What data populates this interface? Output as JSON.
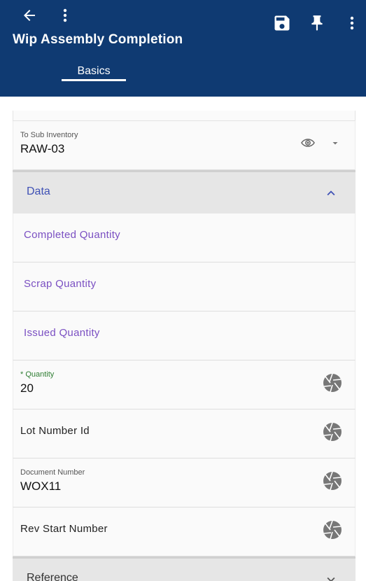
{
  "appbar": {
    "title": "Wip Assembly Completion",
    "tab": "Basics"
  },
  "fields": {
    "to_sub_inventory": {
      "label": "To Sub Inventory",
      "value": "RAW-03"
    },
    "completed_quantity": {
      "label": "Completed Quantity"
    },
    "scrap_quantity": {
      "label": "Scrap Quantity"
    },
    "issued_quantity": {
      "label": "Issued Quantity"
    },
    "quantity": {
      "required_mark": "*",
      "label": "Quantity",
      "value": "20"
    },
    "lot_number_id": {
      "label": "Lot Number Id"
    },
    "document_number": {
      "label": "Document Number",
      "value": "WOX11"
    },
    "rev_start_number": {
      "label": "Rev Start Number"
    }
  },
  "sections": {
    "data": {
      "label": "Data",
      "state": "expanded"
    },
    "reference": {
      "label": "Reference",
      "state": "collapsed"
    }
  },
  "colors": {
    "appbar": "#0f3a72",
    "section_label": "#3f51b5",
    "readonly_label": "#7a4fc2",
    "required_label": "#2e7d32"
  }
}
